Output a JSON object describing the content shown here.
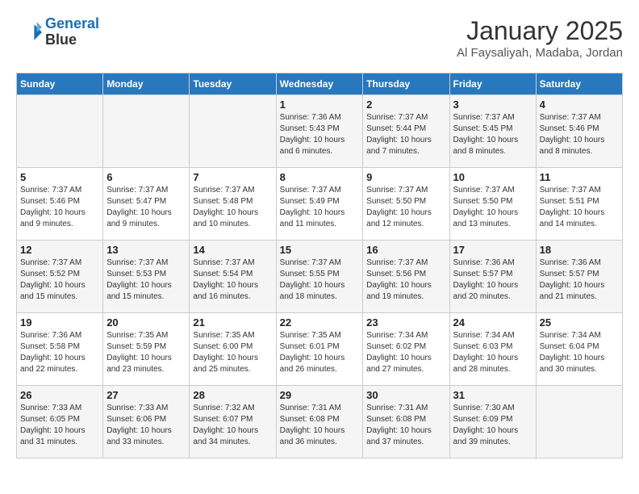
{
  "header": {
    "logo_line1": "General",
    "logo_line2": "Blue",
    "title": "January 2025",
    "subtitle": "Al Faysaliyah, Madaba, Jordan"
  },
  "weekdays": [
    "Sunday",
    "Monday",
    "Tuesday",
    "Wednesday",
    "Thursday",
    "Friday",
    "Saturday"
  ],
  "weeks": [
    [
      {
        "day": "",
        "sunrise": "",
        "sunset": "",
        "daylight": ""
      },
      {
        "day": "",
        "sunrise": "",
        "sunset": "",
        "daylight": ""
      },
      {
        "day": "",
        "sunrise": "",
        "sunset": "",
        "daylight": ""
      },
      {
        "day": "1",
        "sunrise": "Sunrise: 7:36 AM",
        "sunset": "Sunset: 5:43 PM",
        "daylight": "Daylight: 10 hours and 6 minutes."
      },
      {
        "day": "2",
        "sunrise": "Sunrise: 7:37 AM",
        "sunset": "Sunset: 5:44 PM",
        "daylight": "Daylight: 10 hours and 7 minutes."
      },
      {
        "day": "3",
        "sunrise": "Sunrise: 7:37 AM",
        "sunset": "Sunset: 5:45 PM",
        "daylight": "Daylight: 10 hours and 8 minutes."
      },
      {
        "day": "4",
        "sunrise": "Sunrise: 7:37 AM",
        "sunset": "Sunset: 5:46 PM",
        "daylight": "Daylight: 10 hours and 8 minutes."
      }
    ],
    [
      {
        "day": "5",
        "sunrise": "Sunrise: 7:37 AM",
        "sunset": "Sunset: 5:46 PM",
        "daylight": "Daylight: 10 hours and 9 minutes."
      },
      {
        "day": "6",
        "sunrise": "Sunrise: 7:37 AM",
        "sunset": "Sunset: 5:47 PM",
        "daylight": "Daylight: 10 hours and 9 minutes."
      },
      {
        "day": "7",
        "sunrise": "Sunrise: 7:37 AM",
        "sunset": "Sunset: 5:48 PM",
        "daylight": "Daylight: 10 hours and 10 minutes."
      },
      {
        "day": "8",
        "sunrise": "Sunrise: 7:37 AM",
        "sunset": "Sunset: 5:49 PM",
        "daylight": "Daylight: 10 hours and 11 minutes."
      },
      {
        "day": "9",
        "sunrise": "Sunrise: 7:37 AM",
        "sunset": "Sunset: 5:50 PM",
        "daylight": "Daylight: 10 hours and 12 minutes."
      },
      {
        "day": "10",
        "sunrise": "Sunrise: 7:37 AM",
        "sunset": "Sunset: 5:50 PM",
        "daylight": "Daylight: 10 hours and 13 minutes."
      },
      {
        "day": "11",
        "sunrise": "Sunrise: 7:37 AM",
        "sunset": "Sunset: 5:51 PM",
        "daylight": "Daylight: 10 hours and 14 minutes."
      }
    ],
    [
      {
        "day": "12",
        "sunrise": "Sunrise: 7:37 AM",
        "sunset": "Sunset: 5:52 PM",
        "daylight": "Daylight: 10 hours and 15 minutes."
      },
      {
        "day": "13",
        "sunrise": "Sunrise: 7:37 AM",
        "sunset": "Sunset: 5:53 PM",
        "daylight": "Daylight: 10 hours and 15 minutes."
      },
      {
        "day": "14",
        "sunrise": "Sunrise: 7:37 AM",
        "sunset": "Sunset: 5:54 PM",
        "daylight": "Daylight: 10 hours and 16 minutes."
      },
      {
        "day": "15",
        "sunrise": "Sunrise: 7:37 AM",
        "sunset": "Sunset: 5:55 PM",
        "daylight": "Daylight: 10 hours and 18 minutes."
      },
      {
        "day": "16",
        "sunrise": "Sunrise: 7:37 AM",
        "sunset": "Sunset: 5:56 PM",
        "daylight": "Daylight: 10 hours and 19 minutes."
      },
      {
        "day": "17",
        "sunrise": "Sunrise: 7:36 AM",
        "sunset": "Sunset: 5:57 PM",
        "daylight": "Daylight: 10 hours and 20 minutes."
      },
      {
        "day": "18",
        "sunrise": "Sunrise: 7:36 AM",
        "sunset": "Sunset: 5:57 PM",
        "daylight": "Daylight: 10 hours and 21 minutes."
      }
    ],
    [
      {
        "day": "19",
        "sunrise": "Sunrise: 7:36 AM",
        "sunset": "Sunset: 5:58 PM",
        "daylight": "Daylight: 10 hours and 22 minutes."
      },
      {
        "day": "20",
        "sunrise": "Sunrise: 7:35 AM",
        "sunset": "Sunset: 5:59 PM",
        "daylight": "Daylight: 10 hours and 23 minutes."
      },
      {
        "day": "21",
        "sunrise": "Sunrise: 7:35 AM",
        "sunset": "Sunset: 6:00 PM",
        "daylight": "Daylight: 10 hours and 25 minutes."
      },
      {
        "day": "22",
        "sunrise": "Sunrise: 7:35 AM",
        "sunset": "Sunset: 6:01 PM",
        "daylight": "Daylight: 10 hours and 26 minutes."
      },
      {
        "day": "23",
        "sunrise": "Sunrise: 7:34 AM",
        "sunset": "Sunset: 6:02 PM",
        "daylight": "Daylight: 10 hours and 27 minutes."
      },
      {
        "day": "24",
        "sunrise": "Sunrise: 7:34 AM",
        "sunset": "Sunset: 6:03 PM",
        "daylight": "Daylight: 10 hours and 28 minutes."
      },
      {
        "day": "25",
        "sunrise": "Sunrise: 7:34 AM",
        "sunset": "Sunset: 6:04 PM",
        "daylight": "Daylight: 10 hours and 30 minutes."
      }
    ],
    [
      {
        "day": "26",
        "sunrise": "Sunrise: 7:33 AM",
        "sunset": "Sunset: 6:05 PM",
        "daylight": "Daylight: 10 hours and 31 minutes."
      },
      {
        "day": "27",
        "sunrise": "Sunrise: 7:33 AM",
        "sunset": "Sunset: 6:06 PM",
        "daylight": "Daylight: 10 hours and 33 minutes."
      },
      {
        "day": "28",
        "sunrise": "Sunrise: 7:32 AM",
        "sunset": "Sunset: 6:07 PM",
        "daylight": "Daylight: 10 hours and 34 minutes."
      },
      {
        "day": "29",
        "sunrise": "Sunrise: 7:31 AM",
        "sunset": "Sunset: 6:08 PM",
        "daylight": "Daylight: 10 hours and 36 minutes."
      },
      {
        "day": "30",
        "sunrise": "Sunrise: 7:31 AM",
        "sunset": "Sunset: 6:08 PM",
        "daylight": "Daylight: 10 hours and 37 minutes."
      },
      {
        "day": "31",
        "sunrise": "Sunrise: 7:30 AM",
        "sunset": "Sunset: 6:09 PM",
        "daylight": "Daylight: 10 hours and 39 minutes."
      },
      {
        "day": "",
        "sunrise": "",
        "sunset": "",
        "daylight": ""
      }
    ]
  ]
}
